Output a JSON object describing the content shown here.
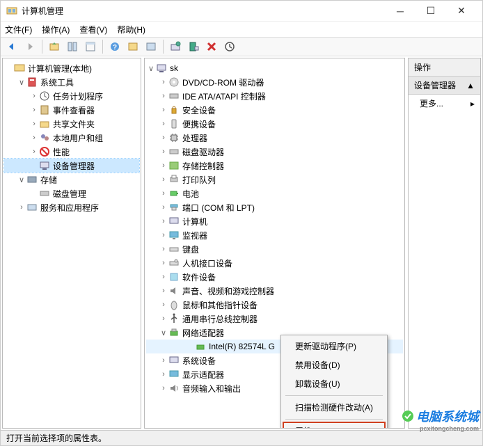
{
  "window": {
    "title": "计算机管理"
  },
  "menus": {
    "file": "文件(F)",
    "action": "操作(A)",
    "view": "查看(V)",
    "help": "帮助(H)"
  },
  "left_tree": {
    "root": "计算机管理(本地)",
    "system_tools": "系统工具",
    "task_scheduler": "任务计划程序",
    "event_viewer": "事件查看器",
    "shared_folders": "共享文件夹",
    "local_users": "本地用户和组",
    "performance": "性能",
    "device_manager": "设备管理器",
    "storage": "存储",
    "disk_mgmt": "磁盘管理",
    "services": "服务和应用程序"
  },
  "mid_tree": {
    "root": "sk",
    "dvd": "DVD/CD-ROM 驱动器",
    "ide": "IDE ATA/ATAPI 控制器",
    "security": "安全设备",
    "portable": "便携设备",
    "cpu": "处理器",
    "disk": "磁盘驱动器",
    "storage_ctrl": "存储控制器",
    "print_queue": "打印队列",
    "battery": "电池",
    "ports": "端口 (COM 和 LPT)",
    "computer": "计算机",
    "monitor": "监视器",
    "keyboard": "键盘",
    "hid": "人机接口设备",
    "software": "软件设备",
    "sound": "声音、视频和游戏控制器",
    "mouse": "鼠标和其他指针设备",
    "usb": "通用串行总线控制器",
    "network": "网络适配器",
    "nic": "Intel(R) 82574L G",
    "system_dev": "系统设备",
    "display": "显示适配器",
    "audio_io": "音频输入和输出"
  },
  "context": {
    "update": "更新驱动程序(P)",
    "disable": "禁用设备(D)",
    "uninstall": "卸载设备(U)",
    "scan": "扫描检测硬件改动(A)",
    "properties": "属性(R)"
  },
  "actions": {
    "title": "操作",
    "section": "设备管理器",
    "more": "更多..."
  },
  "status": "打开当前选择项的属性表。",
  "watermark": {
    "main": "电脑系统城",
    "sub": "pcxitongcheng.com"
  }
}
